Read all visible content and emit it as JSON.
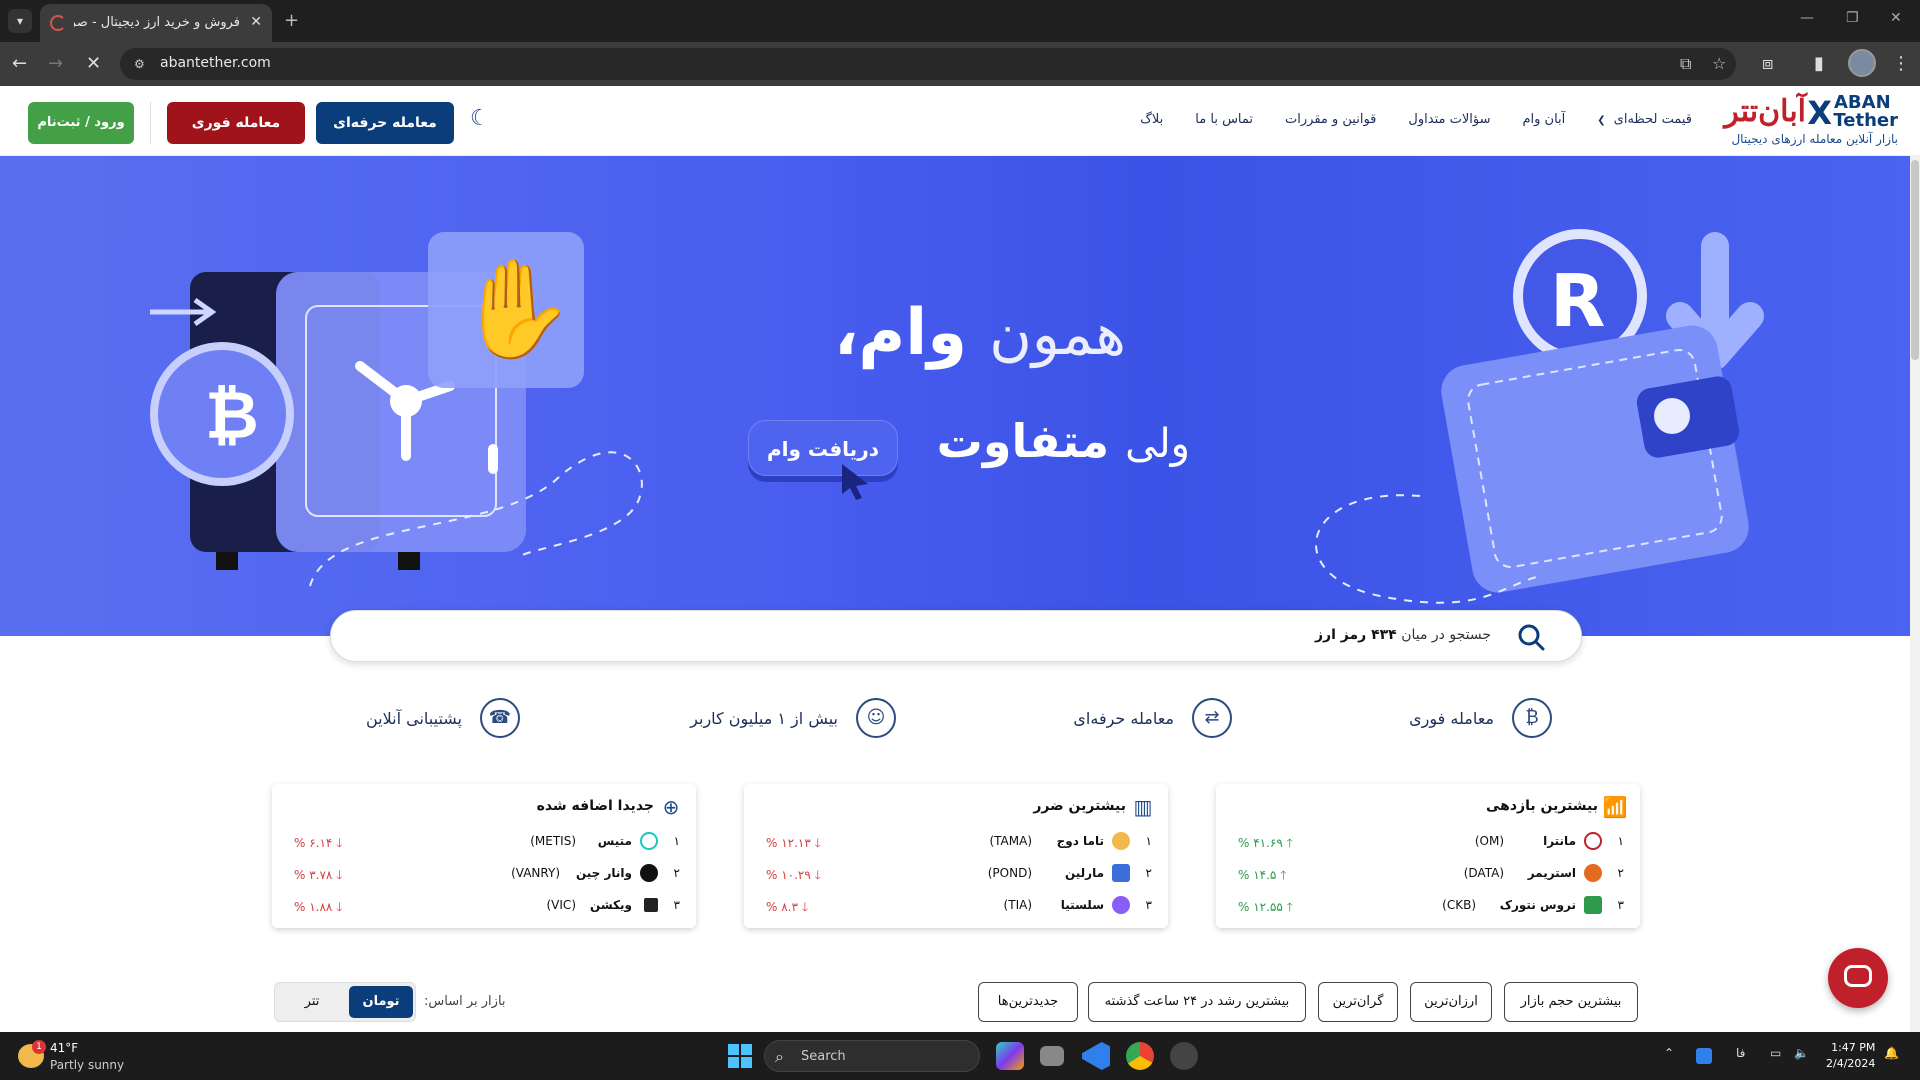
{
  "browser": {
    "tab_title": "فروش و خرید ارز دیجیتال - صرافی",
    "url": "abantether.com"
  },
  "header": {
    "logo_fa": "آبان‌تتر",
    "logo_en_1": "ABAN",
    "logo_en_2": "Tether",
    "tagline": "بازار آنلاین معامله ارزهای دیجیتال",
    "nav": [
      "قیمت لحظه‌ای",
      "آبان وام",
      "سؤالات متداول",
      "قوانین و مقررات",
      "تماس با ما",
      "بلاگ"
    ],
    "btn_pro": "معامله حرفه‌ای",
    "btn_fast": "معامله فوری",
    "btn_login": "ورود / ثبت‌نام"
  },
  "hero": {
    "line1_a": "همون",
    "line1_b": "وام،",
    "line2_a": "ولی",
    "line2_b": "متفاوت",
    "cta": "دریافت وام"
  },
  "search": {
    "text_a": "جستجو در میان",
    "count": "۴۳۴ رمز ارز"
  },
  "features": [
    "معامله فوری",
    "معامله حرفه‌ای",
    "بیش از ۱ میلیون کاربر",
    "پشتیبانی آنلاین"
  ],
  "cards": [
    {
      "title": "بیشترین بازدهی",
      "rows": [
        {
          "rank": "۱",
          "name": "مانترا",
          "sym": "(OM)",
          "chg": "% ۴۱.۶۹",
          "dir": "up",
          "color": "#c0202a"
        },
        {
          "rank": "۲",
          "name": "استریمر",
          "sym": "(DATA)",
          "chg": "% ۱۴.۵",
          "dir": "up",
          "color": "#e36b1e"
        },
        {
          "rank": "۳",
          "name": "نروس نتورک",
          "sym": "(CKB)",
          "chg": "% ۱۲.۵۵",
          "dir": "up",
          "color": "#2e9b4a"
        }
      ]
    },
    {
      "title": "بیشترین ضرر",
      "rows": [
        {
          "rank": "۱",
          "name": "تاما دوج",
          "sym": "(TAMA)",
          "chg": "% ۱۲.۱۳",
          "dir": "down",
          "color": "#f2b84b"
        },
        {
          "rank": "۲",
          "name": "مارلین",
          "sym": "(POND)",
          "chg": "% ۱۰.۲۹",
          "dir": "down",
          "color": "#3b6fd8"
        },
        {
          "rank": "۳",
          "name": "سلستیا",
          "sym": "(TIA)",
          "chg": "% ۸.۳",
          "dir": "down",
          "color": "#8b5cf6"
        }
      ]
    },
    {
      "title": "جدیدا اضافه شده",
      "rows": [
        {
          "rank": "۱",
          "name": "متیس",
          "sym": "(METIS)",
          "chg": "% ۶.۱۴",
          "dir": "down",
          "color": "#19c7c1"
        },
        {
          "rank": "۲",
          "name": "وانار چین",
          "sym": "(VANRY)",
          "chg": "% ۳.۷۸",
          "dir": "down",
          "color": "#111111"
        },
        {
          "rank": "۳",
          "name": "ویکشن",
          "sym": "(VIC)",
          "chg": "% ۱.۸۸",
          "dir": "down",
          "color": "#222222"
        }
      ]
    }
  ],
  "filters": [
    "بیشترین حجم بازار",
    "ارزان‌ترین",
    "گران‌ترین",
    "بیشترین رشد در ۲۴ ساعت گذشته",
    "جدیدترین‌ها"
  ],
  "market_toggle": {
    "label": "بازار بر اساس:",
    "active": "تومان",
    "other": "تتر"
  },
  "taskbar": {
    "temp": "41°F",
    "weather": "Partly sunny",
    "badge": "1",
    "search": "Search",
    "lang": "فا",
    "time": "1:47 PM",
    "date": "2/4/2024"
  },
  "colors": {
    "brand_blue": "#0b3d7a",
    "brand_red": "#a0131a",
    "hero": "#4a5ef0",
    "green": "#43a047"
  }
}
